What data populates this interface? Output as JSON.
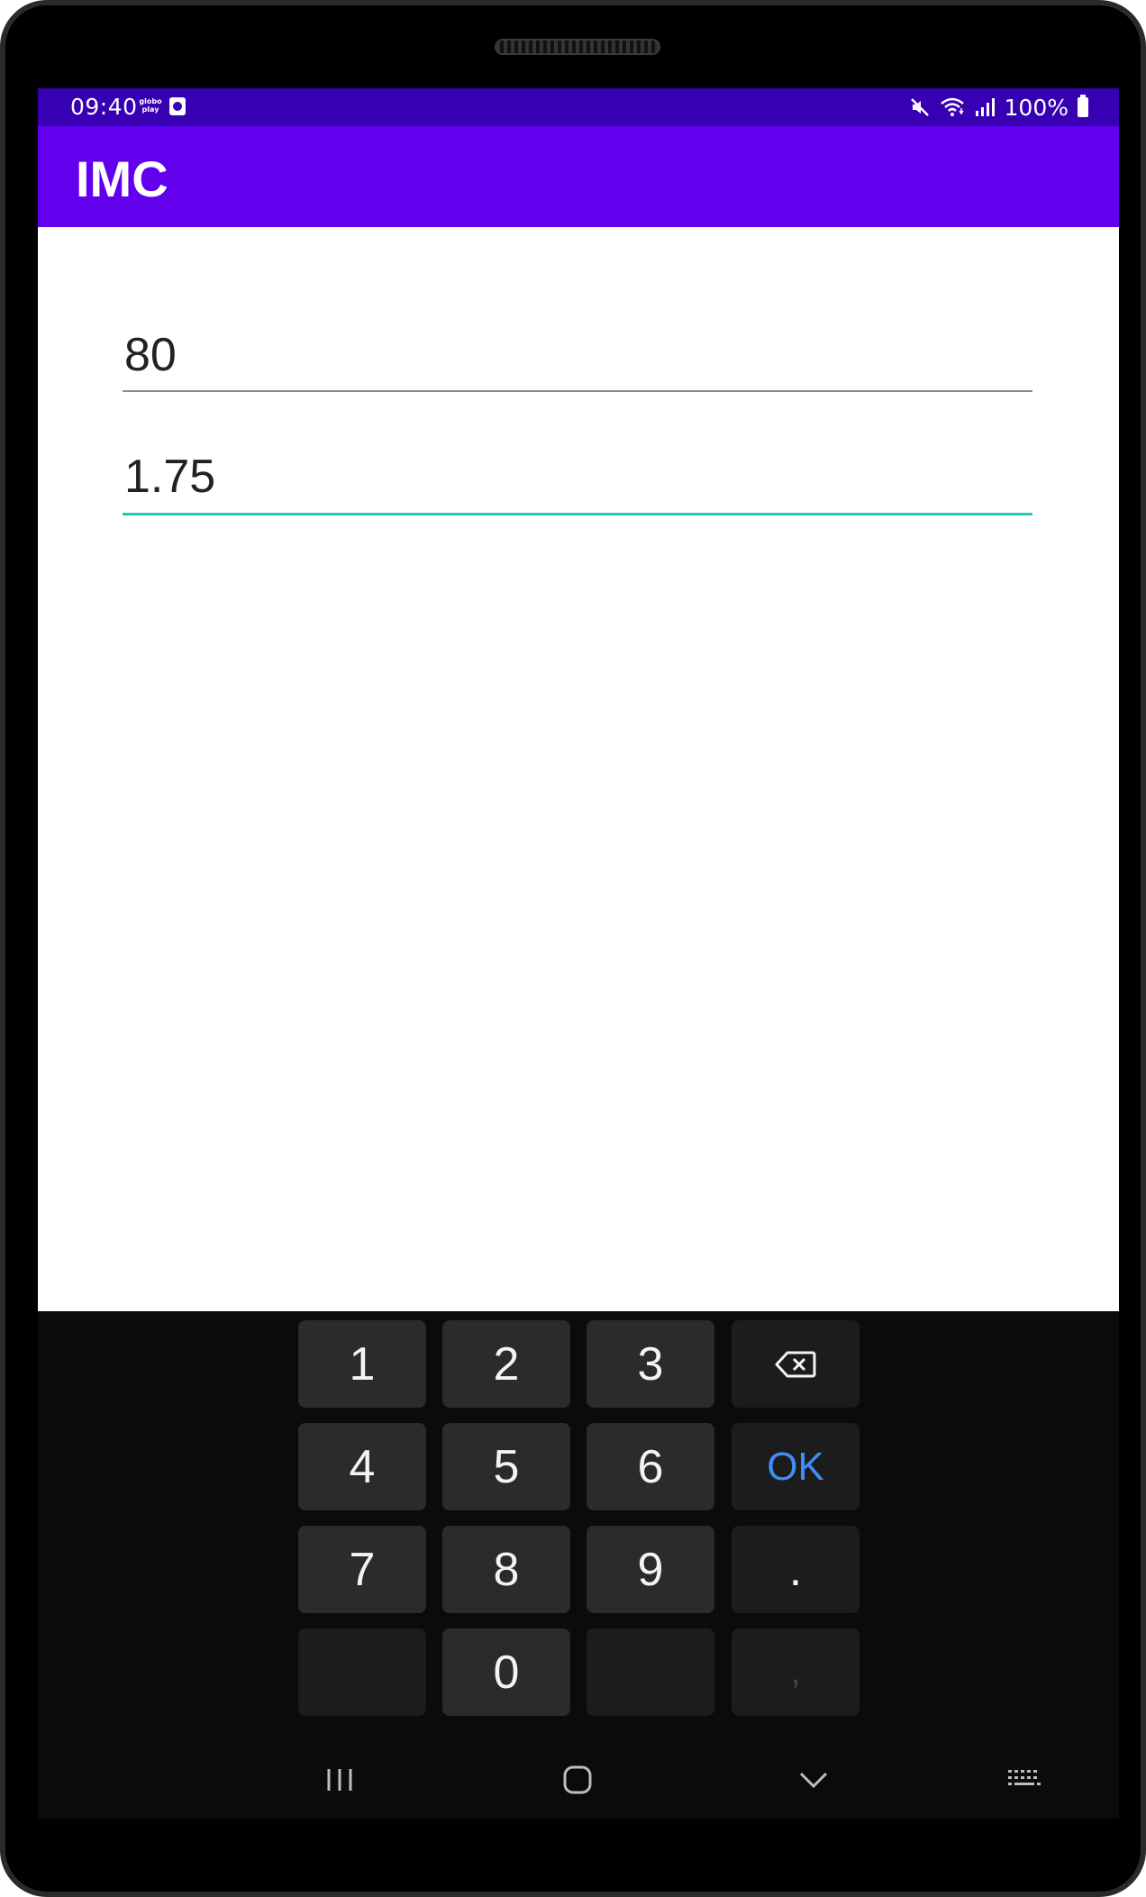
{
  "status_bar": {
    "time": "09:40",
    "globoplay_line1": "globo",
    "globoplay_line2": "play",
    "battery_text": "100%"
  },
  "app_bar": {
    "title": "IMC"
  },
  "form": {
    "weight_value": "80",
    "height_value": "1.75"
  },
  "keyboard": {
    "keys": {
      "k1": "1",
      "k2": "2",
      "k3": "3",
      "k4": "4",
      "k5": "5",
      "k6": "6",
      "k7": "7",
      "k8": "8",
      "k9": "9",
      "k0": "0",
      "ok": "OK",
      "dot": ".",
      "comma": ","
    }
  },
  "colors": {
    "status_bar": "#3700b3",
    "app_bar": "#6200ee",
    "focused_underline": "#1ecbb6",
    "ok_key": "#3d8ef5"
  },
  "icons": {
    "backspace": "backspace-icon",
    "recents": "recent-apps-icon",
    "home": "home-icon",
    "back": "hide-keyboard-icon",
    "keyboard": "keyboard-switch-icon"
  }
}
